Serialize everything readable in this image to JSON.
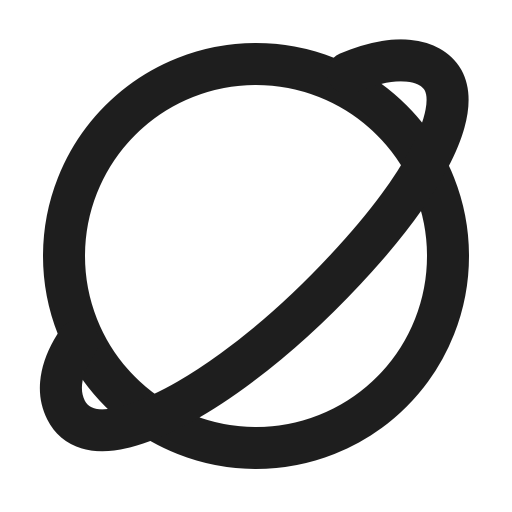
{
  "icon": {
    "name": "planet-icon",
    "color": "#1e1e1e",
    "background": "#ffffff"
  }
}
